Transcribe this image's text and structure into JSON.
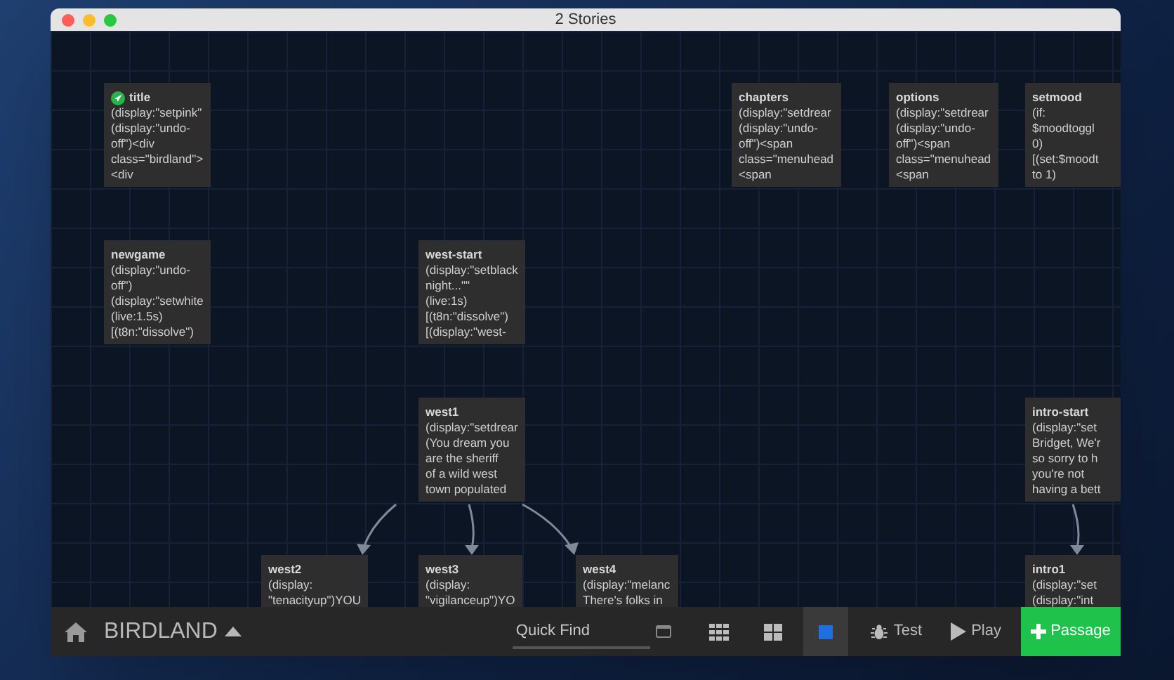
{
  "window": {
    "title": "2 Stories"
  },
  "passages": [
    {
      "name": "title",
      "start": true,
      "body": "(display:\"setpink\"\n(display:\"undo-\noff\")<div\nclass=\"birdland\">\n<div"
    },
    {
      "name": "chapters",
      "start": false,
      "body": "(display:\"setdrear\n(display:\"undo-\noff\")<span\nclass=\"menuhead\n<span"
    },
    {
      "name": "options",
      "start": false,
      "body": "(display:\"setdrear\n(display:\"undo-\noff\")<span\nclass=\"menuhead\n<span"
    },
    {
      "name": "setmood",
      "start": false,
      "body": "(if:\n$moodtoggl\n0)\n[(set:$moodt\nto 1)"
    },
    {
      "name": "newgame",
      "start": false,
      "body": "(display:\"undo-\noff\")\n(display:\"setwhite\n(live:1.5s)\n[(t8n:\"dissolve\")"
    },
    {
      "name": "west-start",
      "start": false,
      "body": "(display:\"setblack\nnight...\"\"\n(live:1s)\n[(t8n:\"dissolve\")\n[(display:\"west-"
    },
    {
      "name": "west1",
      "start": false,
      "body": "(display:\"setdrear\n(You dream you\nare the sheriff\nof a wild west\ntown populated"
    },
    {
      "name": "intro-start",
      "start": false,
      "body": "(display:\"set\nBridget, We'r\nso sorry to h\nyou're not\nhaving a bett"
    },
    {
      "name": "west2",
      "start": false,
      "body": "(display:\n\"tenacityup\")YOU"
    },
    {
      "name": "west3",
      "start": false,
      "body": "(display:\n\"vigilanceup\")YO"
    },
    {
      "name": "west4",
      "start": false,
      "body": "(display:\"melanc\nThere's folks in"
    },
    {
      "name": "intro1",
      "start": false,
      "body": "(display:\"set\n(display:\"int"
    }
  ],
  "toolbar": {
    "story_name": "BIRDLAND",
    "quick_find": {
      "placeholder": "Quick Find"
    },
    "zoom_levels": [
      {
        "kind": "small",
        "selected": false
      },
      {
        "kind": "medium",
        "selected": false
      },
      {
        "kind": "large",
        "selected": true
      }
    ],
    "buttons": [
      {
        "kind": "test",
        "label": "Test"
      },
      {
        "kind": "play",
        "label": "Play"
      },
      {
        "kind": "add",
        "label": "Passage"
      }
    ]
  }
}
